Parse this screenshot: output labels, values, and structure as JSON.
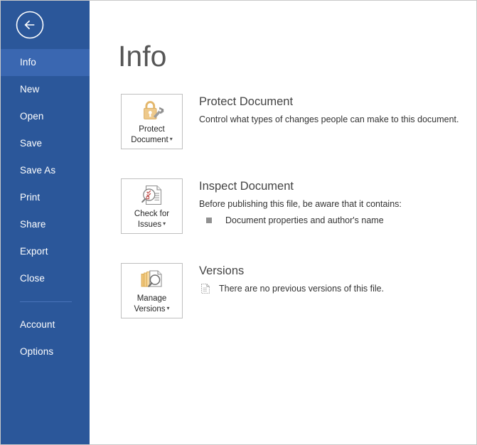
{
  "window": {
    "backstage_title": "Info",
    "back_icon": "back-arrow-icon"
  },
  "sidebar": {
    "items": [
      {
        "label": "Info",
        "selected": true
      },
      {
        "label": "New",
        "selected": false
      },
      {
        "label": "Open",
        "selected": false
      },
      {
        "label": "Save",
        "selected": false
      },
      {
        "label": "Save As",
        "selected": false
      },
      {
        "label": "Print",
        "selected": false
      },
      {
        "label": "Share",
        "selected": false
      },
      {
        "label": "Export",
        "selected": false
      },
      {
        "label": "Close",
        "selected": false
      }
    ],
    "footer_items": [
      {
        "label": "Account"
      },
      {
        "label": "Options"
      }
    ],
    "colors": {
      "background": "#2b579a",
      "selected": "#3a67b1",
      "divider": "#4a74ba",
      "text": "#ffffff"
    }
  },
  "main": {
    "title": "Info",
    "sections": [
      {
        "id": "protect-document",
        "button": {
          "label_line1": "Protect",
          "label_line2": "Document",
          "caret": "▾",
          "icon": "padlock-key-icon"
        },
        "heading": "Protect Document",
        "description": "Control what types of changes people can make to this document.",
        "bullets": []
      },
      {
        "id": "inspect-document",
        "button": {
          "label_line1": "Check for",
          "label_line2": "Issues",
          "caret": "▾",
          "icon": "document-checklist-magnifier-icon"
        },
        "heading": "Inspect Document",
        "description": "Before publishing this file, be aware that it contains:",
        "bullets": [
          {
            "marker": "square-bullet",
            "text": "Document properties and author's name"
          }
        ]
      },
      {
        "id": "versions",
        "button": {
          "label_line1": "Manage",
          "label_line2": "Versions",
          "caret": "▾",
          "icon": "document-stack-magnifier-icon"
        },
        "heading": "Versions",
        "description": "",
        "bullets": [
          {
            "marker": "dotted-document-icon",
            "text": "There are no previous versions of this file."
          }
        ]
      }
    ]
  },
  "colors": {
    "accent": "#2b579a",
    "icon_gold": "#e8c077",
    "icon_gray": "#7a7a7a",
    "icon_red": "#c0504d",
    "heading_text": "#444444",
    "body_text": "#333333",
    "button_border": "#bfbfbf"
  }
}
